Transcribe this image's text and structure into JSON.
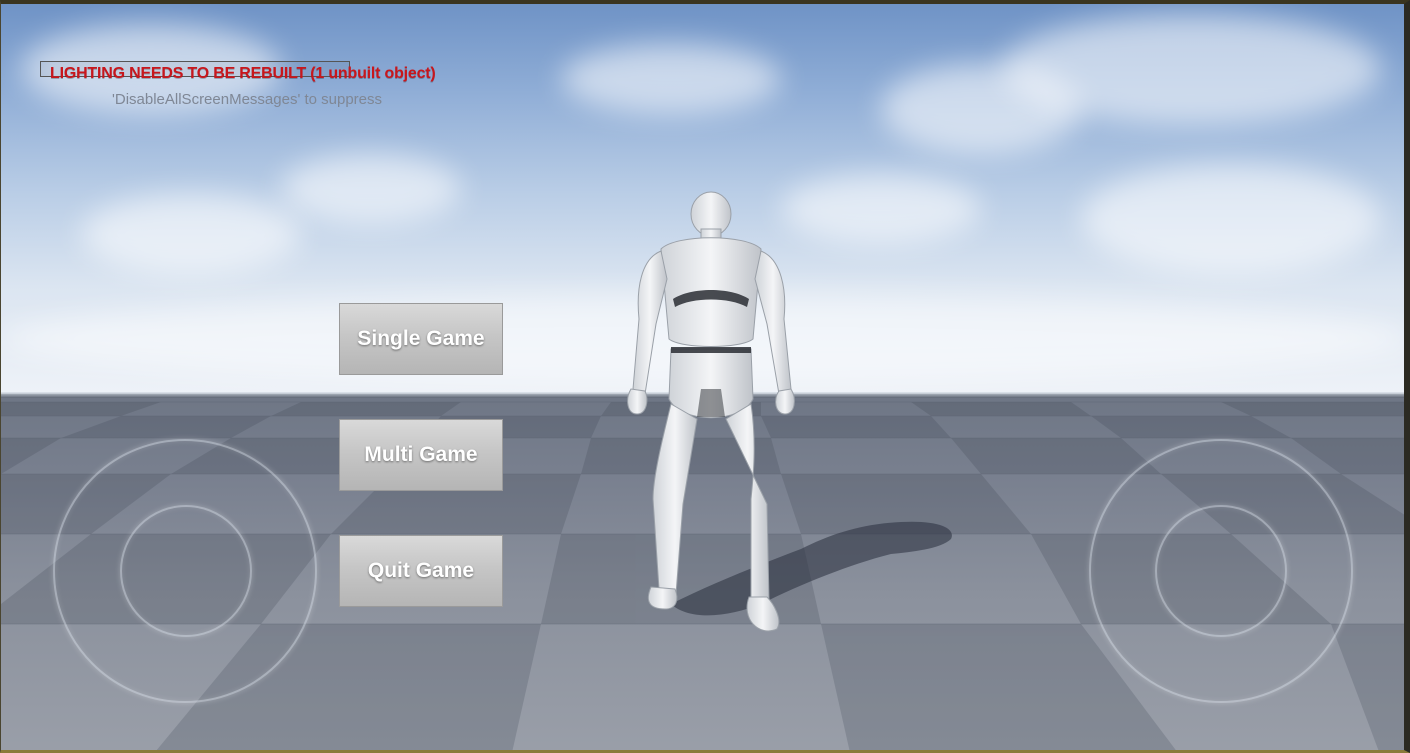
{
  "screen_messages": {
    "warning": "LIGHTING NEEDS TO BE REBUILT (1 unbuilt object)",
    "hint": "'DisableAllScreenMessages' to suppress"
  },
  "menu": {
    "single_game": "Single Game",
    "multi_game": "Multi Game",
    "quit_game": "Quit Game"
  },
  "colors": {
    "warning_text": "#c8161c",
    "button_face": "#c6c6c6",
    "button_text": "#ffffff"
  },
  "icons": {
    "left_joystick": "virtual-joystick-left",
    "right_joystick": "virtual-joystick-right"
  }
}
